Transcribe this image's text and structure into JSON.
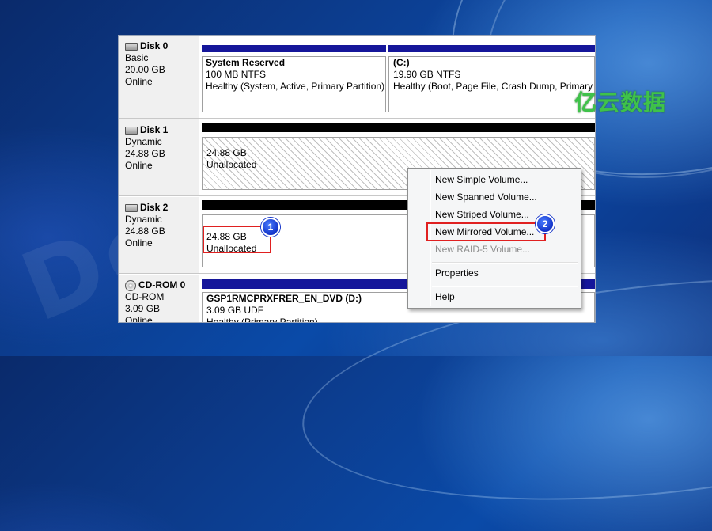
{
  "watermark": {
    "logo_text": "亿云数据",
    "faint_text": "DevBuglo"
  },
  "disks": [
    {
      "name": "Disk 0",
      "type": "Basic",
      "size": "20.00 GB",
      "status": "Online",
      "volumes": [
        {
          "title": "System Reserved",
          "fs": "100 MB NTFS",
          "health": "Healthy (System, Active, Primary Partition)"
        },
        {
          "title": "(C:)",
          "fs": "19.90 GB NTFS",
          "health": "Healthy (Boot, Page File, Crash Dump, Primary Partition)"
        }
      ]
    },
    {
      "name": "Disk 1",
      "type": "Dynamic",
      "size": "24.88 GB",
      "status": "Online",
      "volumes": [
        {
          "size": "24.88 GB",
          "state": "Unallocated"
        }
      ]
    },
    {
      "name": "Disk 2",
      "type": "Dynamic",
      "size": "24.88 GB",
      "status": "Online",
      "volumes": [
        {
          "size": "24.88 GB",
          "state": "Unallocated"
        }
      ]
    },
    {
      "name": "CD-ROM 0",
      "type": "CD-ROM",
      "size": "3.09 GB",
      "status": "Online",
      "volumes": [
        {
          "title": "GSP1RMCPRXFRER_EN_DVD  (D:)",
          "fs": "3.09 GB UDF",
          "health": "Healthy (Primary Partition)"
        }
      ]
    }
  ],
  "context_menu": {
    "items": [
      {
        "label": "New Simple Volume...",
        "enabled": true
      },
      {
        "label": "New Spanned Volume...",
        "enabled": true
      },
      {
        "label": "New Striped Volume...",
        "enabled": true
      },
      {
        "label": "New Mirrored Volume...",
        "enabled": true
      },
      {
        "label": "New RAID-5 Volume...",
        "enabled": false
      },
      {
        "label": "Properties",
        "enabled": true
      },
      {
        "label": "Help",
        "enabled": true
      }
    ]
  },
  "callouts": {
    "badge_1": "1",
    "badge_2": "2"
  },
  "colors": {
    "partition_bar": "#15169a",
    "dynamic_bar": "#000000",
    "highlight": "#e02020",
    "badge": "#1434c8"
  }
}
